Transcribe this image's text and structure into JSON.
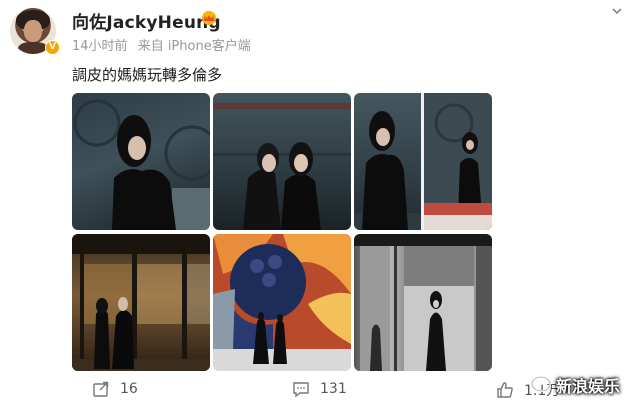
{
  "post": {
    "username": "向佐JackyHeung",
    "time": "14小时前",
    "source": "来自 iPhone客户端",
    "text": "調皮的媽媽玩轉多倫多",
    "vip_badge": "V"
  },
  "actions": {
    "repost_count": "16",
    "comment_count": "131",
    "like_count": "1.1万"
  },
  "watermark": {
    "text": "新浪娱乐"
  },
  "colors": {
    "vip_orange": "#f7a500",
    "meta_gray": "#999999"
  },
  "icons": [
    "chevron-down-icon",
    "crown-icon",
    "repost-icon",
    "comment-icon",
    "like-icon"
  ]
}
